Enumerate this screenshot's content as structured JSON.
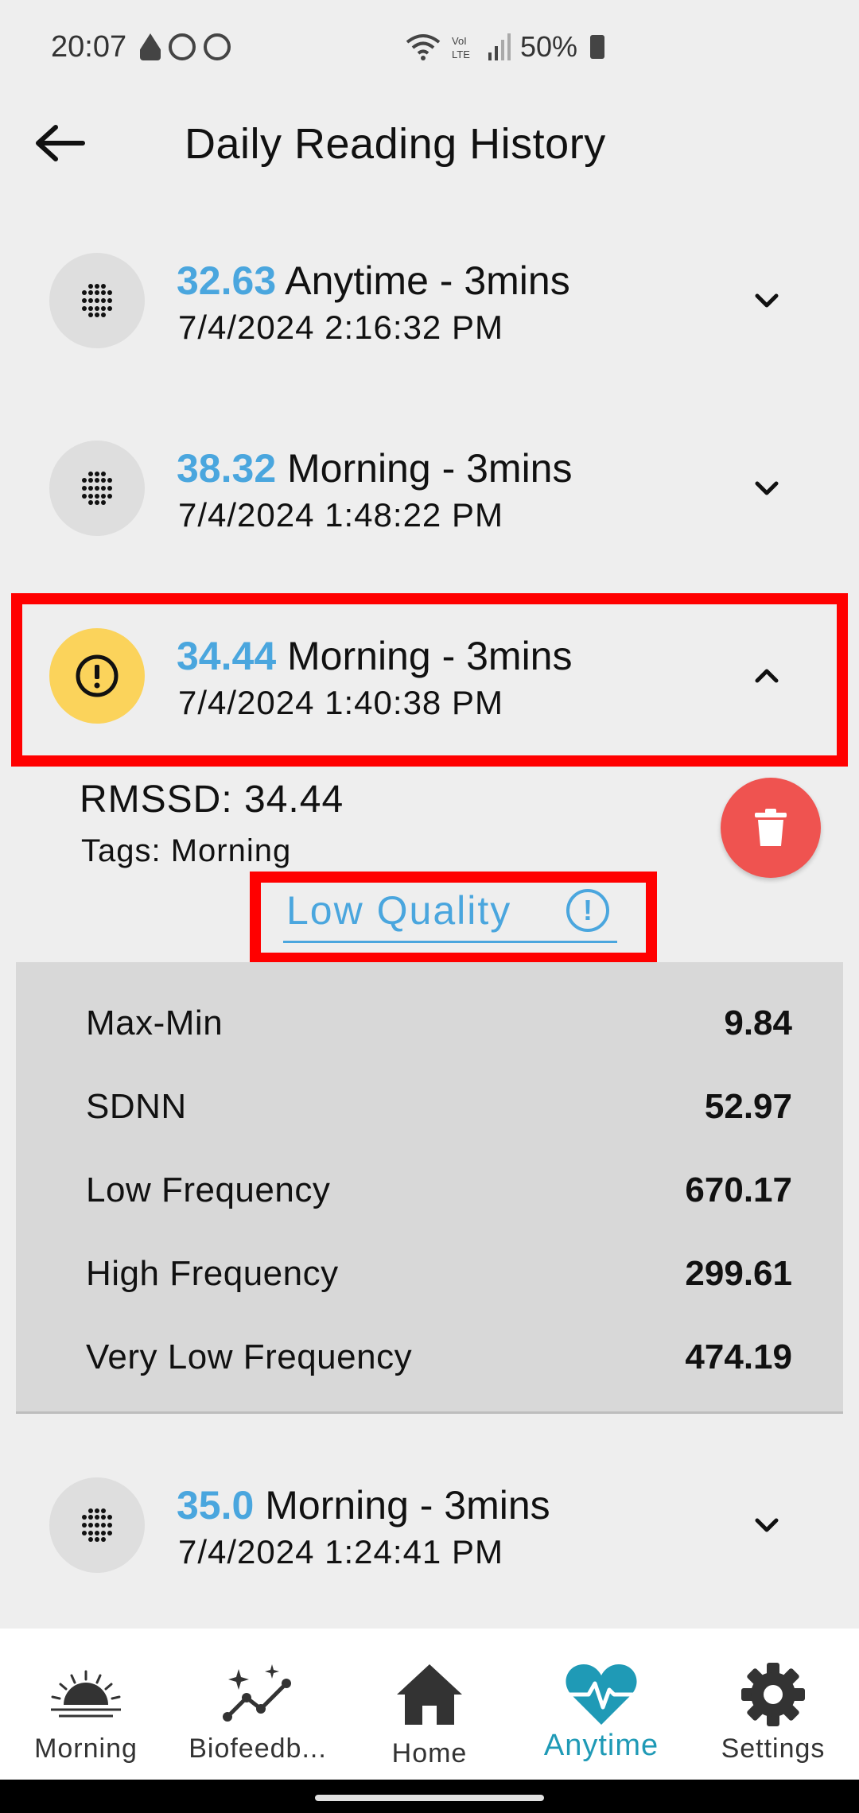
{
  "status_bar": {
    "time": "20:07",
    "left_icons": [
      "mosque-icon",
      "vpn-icon",
      "shazam-icon"
    ],
    "battery": "50%"
  },
  "header": {
    "title": "Daily Reading History"
  },
  "readings": [
    {
      "score": "32.63",
      "label": "Anytime - 3mins",
      "datetime": "7/4/2024 2:16:32 PM",
      "icon": "dots-icon",
      "expanded": false
    },
    {
      "score": "38.32",
      "label": "Morning - 3mins",
      "datetime": "7/4/2024 1:48:22 PM",
      "icon": "dots-icon",
      "expanded": false
    },
    {
      "score": "34.44",
      "label": "Morning - 3mins",
      "datetime": "7/4/2024 1:40:38 PM",
      "icon": "warning-icon",
      "expanded": true
    },
    {
      "score": "35.0",
      "label": "Morning - 3mins",
      "datetime": "7/4/2024 1:24:41 PM",
      "icon": "dots-icon",
      "expanded": false
    }
  ],
  "details": {
    "rmssd": "RMSSD: 34.44",
    "tags": "Tags: Morning",
    "quality": "Low Quality",
    "metrics": [
      {
        "label": "Max-Min",
        "value": "9.84"
      },
      {
        "label": "SDNN",
        "value": "52.97"
      },
      {
        "label": "Low Frequency",
        "value": "670.17"
      },
      {
        "label": "High Frequency",
        "value": "299.61"
      },
      {
        "label": "Very Low Frequency",
        "value": "474.19"
      }
    ]
  },
  "nav": [
    {
      "label": "Morning",
      "icon": "sunrise-icon"
    },
    {
      "label": "Biofeedb...",
      "icon": "sparkle-chart-icon"
    },
    {
      "label": "Home",
      "icon": "home-icon"
    },
    {
      "label": "Anytime",
      "icon": "heart-pulse-icon",
      "active": true
    },
    {
      "label": "Settings",
      "icon": "gear-icon"
    }
  ],
  "colors": {
    "accent": "#4aa6de",
    "active_nav": "#1f9ab6",
    "warning": "#fbd35b",
    "delete": "#ef5350",
    "highlight": "#ff0000"
  }
}
